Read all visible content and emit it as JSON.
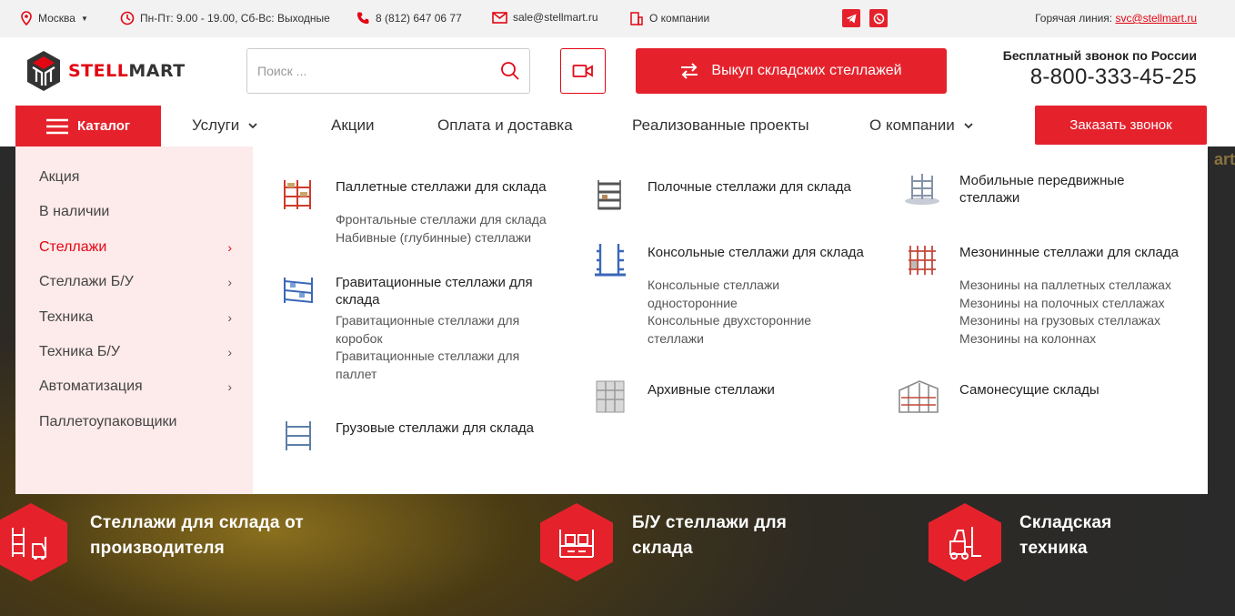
{
  "topbar": {
    "city": "Москва",
    "hours": "Пн-Пт: 9.00 - 19.00, Сб-Вс: Выходные",
    "phone": "8 (812) 647 06 77",
    "email": "sale@stellmart.ru",
    "about": "О компании",
    "hotline_label": "Горячая линия:",
    "hotline_email": "svc@stellmart.ru"
  },
  "header": {
    "logo_part1": "STELL",
    "logo_part2": "MART",
    "search_placeholder": "Поиск ...",
    "buyback_label": "Выкуп складских стеллажей",
    "freecall_label": "Бесплатный звонок по России",
    "freecall_phone": "8-800-333-45-25"
  },
  "nav": {
    "catalog": "Каталог",
    "services": "Услуги",
    "promos": "Акции",
    "payment": "Оплата и доставка",
    "projects": "Реализованные проекты",
    "company": "О компании",
    "order_call": "Заказать звонок"
  },
  "left_menu": [
    {
      "label": "Акция",
      "has_arrow": false,
      "active": false
    },
    {
      "label": "В наличии",
      "has_arrow": false,
      "active": false
    },
    {
      "label": "Стеллажи",
      "has_arrow": true,
      "active": true
    },
    {
      "label": "Стеллажи Б/У",
      "has_arrow": true,
      "active": false
    },
    {
      "label": "Техника",
      "has_arrow": true,
      "active": false
    },
    {
      "label": "Техника Б/У",
      "has_arrow": true,
      "active": false
    },
    {
      "label": "Автоматизация",
      "has_arrow": true,
      "active": false
    },
    {
      "label": "Паллетоупаковщики",
      "has_arrow": false,
      "active": false
    }
  ],
  "categories": {
    "pallet": {
      "title": "Паллетные стеллажи для склада",
      "subs": [
        "Фронтальные стеллажи для склада",
        "Набивные (глубинные) стеллажи"
      ]
    },
    "gravity": {
      "title": "Гравитационные стеллажи для склада",
      "subs": [
        "Гравитационные стеллажи для коробок",
        "Гравитационные стеллажи для паллет"
      ]
    },
    "cargo": {
      "title": "Грузовые стеллажи для склада"
    },
    "shelf": {
      "title": "Полочные стеллажи для склада"
    },
    "cantilever": {
      "title": "Консольные стеллажи для склада",
      "subs": [
        "Консольные стеллажи односторонние",
        "Консольные двухсторонние стеллажи"
      ]
    },
    "archive": {
      "title": "Архивные стеллажи"
    },
    "mobile": {
      "title": "Мобильные передвижные стеллажи"
    },
    "mezzanine": {
      "title": "Мезонинные стеллажи для склада",
      "subs": [
        "Мезонины на паллетных стеллажах",
        "Мезонины на полочных стеллажах",
        "Мезонины на грузовых стеллажах",
        "Мезонины на колоннах"
      ]
    },
    "selfsupport": {
      "title": "Самонесущие склады"
    }
  },
  "promos": [
    {
      "line1": "Стеллажи для склада от",
      "line2": "производителя",
      "icon": "shelving-forklift-icon"
    },
    {
      "line1": "Б/У стеллажи для",
      "line2": "склада",
      "icon": "used-shelving-icon"
    },
    {
      "line1": "Складская",
      "line2": "техника",
      "icon": "forklift-icon"
    }
  ],
  "hero": {
    "ghost_text": "art"
  },
  "colors": {
    "accent": "#e5222c",
    "menu_bg": "#fdeaea"
  }
}
